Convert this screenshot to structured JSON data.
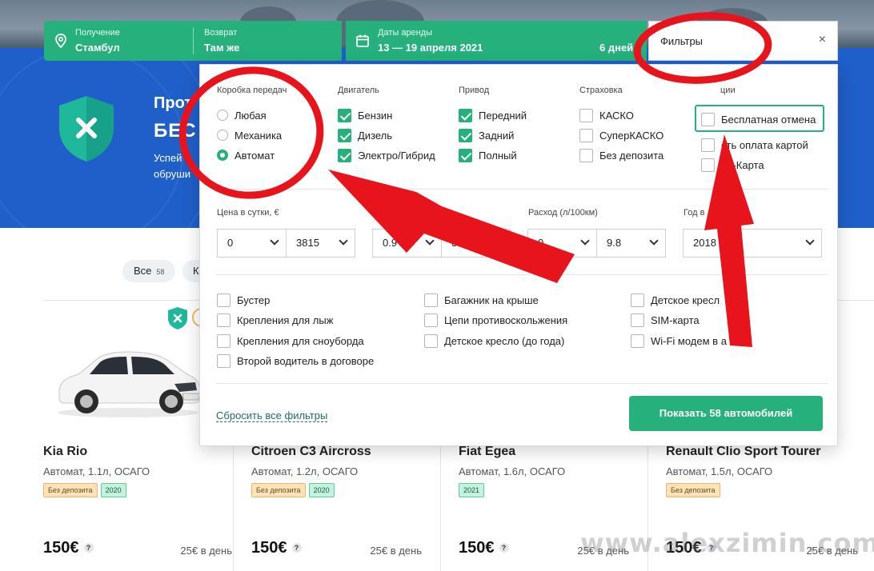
{
  "search": {
    "pickup_label": "Получение",
    "pickup_value": "Стамбул",
    "return_label": "Возврат",
    "return_value": "Там же",
    "dates_label": "Даты аренды",
    "dates_value": "13 — 19 апреля 2021",
    "days": "6 дней",
    "filters_label": "Фильтры",
    "close_symbol": "×"
  },
  "hero": {
    "title": "Прот",
    "big": "БЕС",
    "line1": "Успей",
    "line2": "обруши"
  },
  "tabs": [
    {
      "label": "Все",
      "count": "58"
    },
    {
      "label": "К"
    }
  ],
  "filters": {
    "gearbox": {
      "title": "Коробка передач",
      "options": [
        "Любая",
        "Механика",
        "Автомат"
      ],
      "selected": "Автомат"
    },
    "engine": {
      "title": "Двигатель",
      "options": [
        "Бензин",
        "Дизель",
        "Электро/Гибрид"
      ],
      "checked": [
        true,
        true,
        true
      ]
    },
    "drive": {
      "title": "Привод",
      "options": [
        "Передний",
        "Задний",
        "Полный"
      ],
      "checked": [
        true,
        true,
        true
      ]
    },
    "insurance": {
      "title": "Страховка",
      "options": [
        "КАСКО",
        "СуперКАСКО",
        "Без депозита"
      ],
      "checked": [
        false,
        false,
        false
      ]
    },
    "options": {
      "title": "ции",
      "options": [
        "Бесплатная отмена",
        "сть оплата картой",
        "ин-Карта"
      ],
      "checked": [
        false,
        false,
        false
      ]
    },
    "price": {
      "label": "Цена в сутки, €",
      "from": "0",
      "to": "3815"
    },
    "volume": {
      "label": "Объ",
      "from": "0.9",
      "to": "3"
    },
    "consumption": {
      "label": "Расход (л/100км)",
      "from": "0",
      "to": "9.8"
    },
    "year": {
      "label": "Год в",
      "value": "2018"
    },
    "extras": [
      [
        "Бустер",
        "Крепления для лыж",
        "Крепления для сноуборда",
        "Второй водитель в договоре"
      ],
      [
        "Багажник на крыше",
        "Цепи противоскольжения",
        "Детское кресло (до года)"
      ],
      [
        "Детское кресл",
        "SIM-карта",
        "Wi-Fi модем в а"
      ]
    ],
    "reset": "Сбросить все фильтры",
    "show": "Показать 58 автомобилей"
  },
  "cars": [
    {
      "name": "Kia Rio",
      "spec": "Автомат, 1.1л, ОСАГО",
      "badges": [
        {
          "text": "Без депозита",
          "kind": "orange"
        },
        {
          "text": "2020",
          "kind": "green"
        }
      ],
      "price": "150€",
      "per_day": "25€ в день"
    },
    {
      "name": "Citroen C3 Aircross",
      "spec": "Автомат, 1.2л, ОСАГО",
      "badges": [
        {
          "text": "Без депозита",
          "kind": "orange"
        },
        {
          "text": "2020",
          "kind": "green"
        }
      ],
      "price": "150€",
      "per_day": "25€ в день"
    },
    {
      "name": "Fiat Egea",
      "spec": "Автомат, 1.6л, ОСАГО",
      "badges": [
        {
          "text": "2021",
          "kind": "green"
        }
      ],
      "price": "150€",
      "per_day": "25€ в день"
    },
    {
      "name": "Renault Clio Sport Tourer",
      "spec": "Автомат, 1.5л, ОСАГО",
      "badges": [
        {
          "text": "Без депозита",
          "kind": "orange"
        }
      ],
      "price": "150€",
      "per_day": "25€ в день"
    }
  ],
  "watermark": "www.alexzimin.com",
  "colors": {
    "accent": "#25b07c",
    "hero": "#1f5fc9",
    "annotation": "#e8141c"
  }
}
